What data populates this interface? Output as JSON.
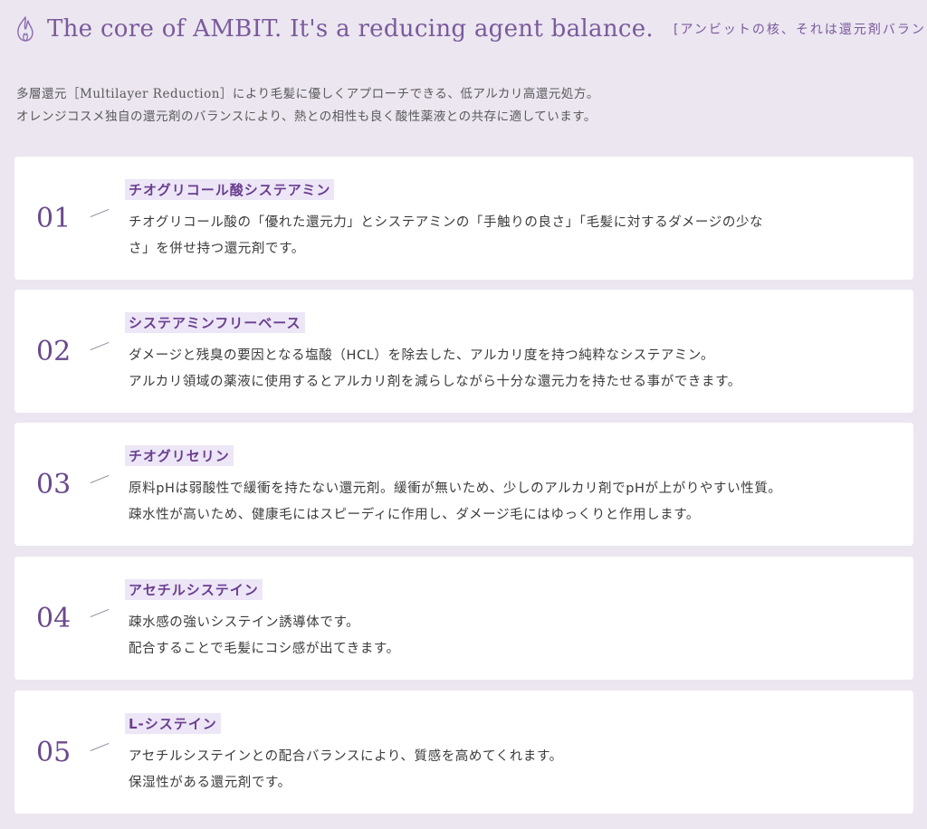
{
  "header": {
    "title_en": "The core of AMBIT. It's a reducing agent balance.",
    "title_jp": "[アンビットの核、それは還元剤バランス]",
    "icon": "flame-icon",
    "accent_color": "#7b5a9c"
  },
  "intro": {
    "line1": "多層還元［Multilayer Reduction］により毛髪に優しくアプローチできる、低アルカリ高還元処方。",
    "line2": "オレンジコスメ独自の還元剤のバランスにより、熱との相性も良く酸性薬液との共存に適しています。"
  },
  "items": [
    {
      "number": "01",
      "name": "チオグリコール酸システアミン",
      "desc_line1": "チオグリコール酸の「優れた還元力」とシステアミンの「手触りの良さ」「毛髪に対するダメージの少な",
      "desc_line2": "さ」を併せ持つ還元剤です。"
    },
    {
      "number": "02",
      "name": "システアミンフリーベース",
      "desc_line1": "ダメージと残臭の要因となる塩酸（HCL）を除去した、アルカリ度を持つ純粋なシステアミン。",
      "desc_line2": "アルカリ領域の薬液に使用するとアルカリ剤を減らしながら十分な還元力を持たせる事ができます。"
    },
    {
      "number": "03",
      "name": "チオグリセリン",
      "desc_line1": "原料pHは弱酸性で緩衝を持たない還元剤。緩衝が無いため、少しのアルカリ剤でpHが上がりやすい性質。",
      "desc_line2": "疎水性が高いため、健康毛にはスピーディに作用し、ダメージ毛にはゆっくりと作用します。"
    },
    {
      "number": "04",
      "name": "アセチルシステイン",
      "desc_line1": "疎水感の強いシステイン誘導体です。",
      "desc_line2": "配合することで毛髪にコシ感が出てきます。"
    },
    {
      "number": "05",
      "name": "L-システイン",
      "desc_line1": "アセチルシステインとの配合バランスにより、質感を高めてくれます。",
      "desc_line2": "保湿性がある還元剤です。"
    }
  ]
}
